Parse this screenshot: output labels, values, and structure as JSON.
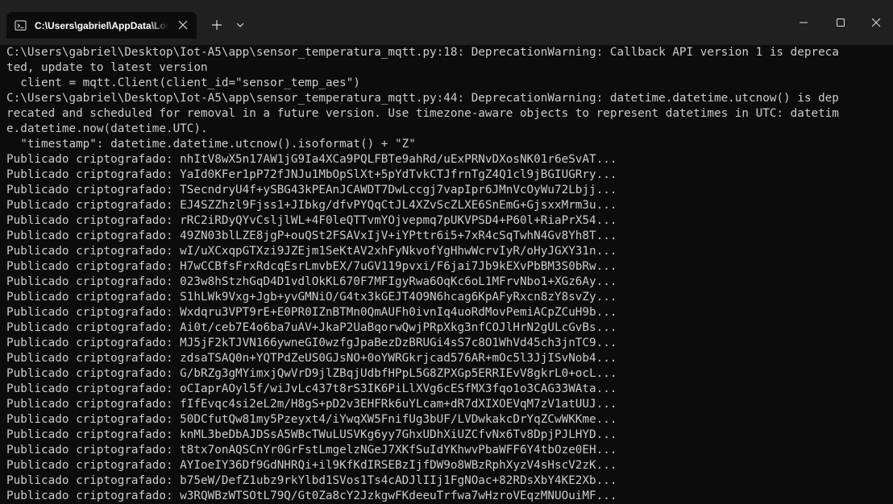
{
  "tab": {
    "title": "C:\\Users\\gabriel\\AppData\\Local\\Microsoft\\WindowsApps\\python.exe"
  },
  "icons": {
    "tab": "terminal-icon",
    "close_tab": "close-icon",
    "new_tab": "plus-icon",
    "dropdown": "chevron-down-icon",
    "minimize": "minimize-icon",
    "maximize": "maximize-icon",
    "close_window": "close-icon"
  },
  "colors": {
    "titlebar": "#202020",
    "terminal_bg": "#0c0c0c",
    "terminal_text": "#cccccc"
  },
  "terminal": {
    "lines": [
      "C:\\Users\\gabriel\\Desktop\\Iot-A5\\app\\sensor_temperatura_mqtt.py:18: DeprecationWarning: Callback API version 1 is depreca",
      "ted, update to latest version",
      "  client = mqtt.Client(client_id=\"sensor_temp_aes\")",
      "C:\\Users\\gabriel\\Desktop\\Iot-A5\\app\\sensor_temperatura_mqtt.py:44: DeprecationWarning: datetime.datetime.utcnow() is dep",
      "recated and scheduled for removal in a future version. Use timezone-aware objects to represent datetimes in UTC: datetim",
      "e.datetime.now(datetime.UTC).",
      "  \"timestamp\": datetime.datetime.utcnow().isoformat() + \"Z\"",
      "Publicado criptografado: nhItV8wX5n17AW1jG9Ia4XCa9PQLFBTe9ahRd/uExPRNvDXosNK01r6eSvAT...",
      "Publicado criptografado: YaId0KFer1pP72fJNJu1MbOpSlXt+5pYdTvkCTJfrnTgZ4Q1cl9jBGIUGRry...",
      "Publicado criptografado: TSecndryU4f+ySBG43kPEAnJCAWDT7DwLccgj7vapIpr6JMnVcOyWu72Lbjj...",
      "Publicado criptografado: EJ4SZZhzl9Fjss1+JIbkg/dfvPYQqCtJL4XZvScZLXE6SnEmG+GjsxxMrm3u...",
      "Publicado criptografado: rRC2iRDyQYvCsljlWL+4F0leQTTvmYOjvepmq7pUKVPSD4+P60l+RiaPrX54...",
      "Publicado criptografado: 49ZN03blLZE8jgP+ouQSt2FSAVxIjV+iYPttr6i5+7xR4cSqTwhN4Gv8Yh8T...",
      "Publicado criptografado: wI/uXCxqpGTXzi9JZEjm1SeKtAV2xhFyNkvofYgHhwWcrvIyR/oHyJGXY31n...",
      "Publicado criptografado: H7wCCBfsFrxRdcqEsrLmvbEX/7uGV119pvxi/F6jai7Jb9kEXvPbBM3S0bRw...",
      "Publicado criptografado: 023w8hStzhGqD4D1vdlOkKL670F7MFIgyRwa6OqKc6oL1MFrvNbo1+XGz6Ay...",
      "Publicado criptografado: S1hLWk9Vxg+Jgb+yvGMNiO/G4tx3kGEJT4O9N6hcag6KpAFyRxcn8zY8svZy...",
      "Publicado criptografado: Wxdqru3VPT9rE+E0PR0IZnBTMn0QmAUFh0ivnIq4uoRdMovPemiACpZCuH9b...",
      "Publicado criptografado: Ai0t/ceb7E4o6ba7uAV+JkaP2UaBqorwQwjPRpXkg3nfCOJlHrN2gULcGvBs...",
      "Publicado criptografado: MJ5jF2kTJVN166ywneGI0wzfgJpaBezDzBRUGi4sS7c8O1WhVd45ch3jnTC9...",
      "Publicado criptografado: zdsaTSAQ0n+YQTPdZeUS0GJsNO+0oYWRGkrjcad576AR+mOc5l3JjISvNob4...",
      "Publicado criptografado: G/bRZg3gMYimxjQwVrD9jlZBqjUdbfHPpL5G8ZPXGp5ERRIEvV8gkrL0+ocL...",
      "Publicado criptografado: oCIaprAOyl5f/wiJvLc437t8rS3IK6PiLlXVg6cESfMX3fqo1o3CAG33WAta...",
      "Publicado criptografado: fIfEvqc4si2eL2m/H8gS+pD2v3EHFRk6uYLcam+dR7dXIXOEVqM7zV1atUUJ...",
      "Publicado criptografado: 50DCfutQw81my5Pzeyxt4/iYwqXW5FnifUg3bUF/LVDwkakcDrYqZCwWKKme...",
      "Publicado criptografado: knML3beDbAJDSsA5WBcTWuLUSVKg6yy7GhxUDhXiUZCfvNx6Tv8DpjPJLHYD...",
      "Publicado criptografado: t8tx7onAQSCnYr0GrFstLmgelzNGeJ7XKfSuIdYKhwvPbaWFF6Y4tbOze0EH...",
      "Publicado criptografado: AYIoeIY36Df9GdNHRQi+il9KfKdIRSEBzIjfDW9o8WBzRphXyzV4sHscV2zK...",
      "Publicado criptografado: b75eW/DefZ1ubz9rkYlbd1SVos1Ts4cADJlIIj1FgNOac+82RDsXbY4KE2Xb...",
      "Publicado criptografado: w3RQWBzWTSOtL79Q/Gt0Za8cY2JzkgwFKdeeuTrfwa7wHzroVEqzMNUOuiMF..."
    ]
  }
}
